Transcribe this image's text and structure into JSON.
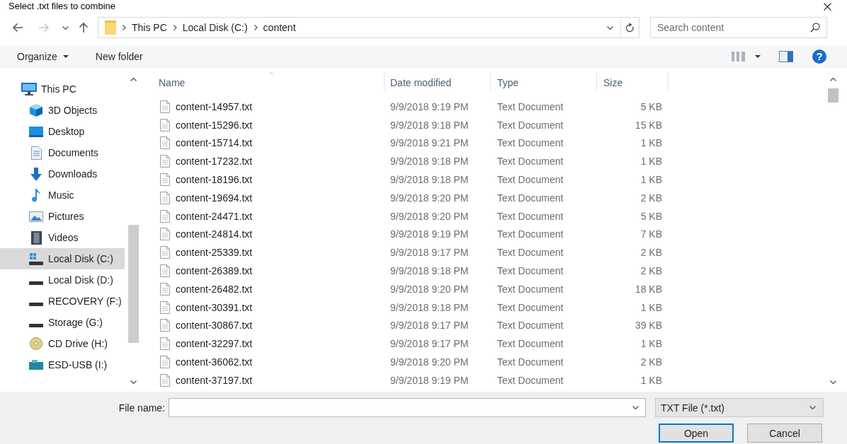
{
  "window": {
    "title": "Select .txt files to combine"
  },
  "nav_buttons": [
    {
      "kind": "back",
      "disabled": false
    },
    {
      "kind": "forward",
      "disabled": true
    },
    {
      "kind": "recent",
      "disabled": false
    },
    {
      "kind": "up",
      "disabled": false
    }
  ],
  "address_bar": {
    "breadcrumbs": [
      "This PC",
      "Local Disk (C:)",
      "content"
    ]
  },
  "search": {
    "placeholder": "Search content"
  },
  "toolbar": {
    "organize": "Organize",
    "new_folder": "New folder",
    "help": "?"
  },
  "sidebar": {
    "items": [
      {
        "label": "This PC",
        "kind": "pc",
        "selected": false,
        "children": [
          {
            "label": "3D Objects",
            "kind": "objects3d",
            "selected": false
          },
          {
            "label": "Desktop",
            "kind": "desktop",
            "selected": false
          },
          {
            "label": "Documents",
            "kind": "documents",
            "selected": false
          },
          {
            "label": "Downloads",
            "kind": "downloads",
            "selected": false
          },
          {
            "label": "Music",
            "kind": "music",
            "selected": false
          },
          {
            "label": "Pictures",
            "kind": "pictures",
            "selected": false
          },
          {
            "label": "Videos",
            "kind": "videos",
            "selected": false
          },
          {
            "label": "Local Disk (C:)",
            "kind": "system_disk",
            "selected": true
          },
          {
            "label": "Local Disk (D:)",
            "kind": "disk",
            "selected": false
          },
          {
            "label": "RECOVERY (F:)",
            "kind": "disk",
            "selected": false
          },
          {
            "label": "Storage (G:)",
            "kind": "disk",
            "selected": false
          },
          {
            "label": "CD Drive (H:)",
            "kind": "cd",
            "selected": false
          },
          {
            "label": "ESD-USB (I:)",
            "kind": "usb",
            "selected": false
          }
        ]
      }
    ]
  },
  "file_list": {
    "columns": [
      {
        "label": "Name",
        "sorted": true
      },
      {
        "label": "Date modified",
        "sorted": false
      },
      {
        "label": "Type",
        "sorted": false
      },
      {
        "label": "Size",
        "sorted": false
      }
    ],
    "rows": [
      {
        "name": "content-14957.txt",
        "date_modified": "9/9/2018 9:19 PM",
        "type": "Text Document",
        "size": "5 KB"
      },
      {
        "name": "content-15296.txt",
        "date_modified": "9/9/2018 9:18 PM",
        "type": "Text Document",
        "size": "15 KB"
      },
      {
        "name": "content-15714.txt",
        "date_modified": "9/9/2018 9:21 PM",
        "type": "Text Document",
        "size": "1 KB"
      },
      {
        "name": "content-17232.txt",
        "date_modified": "9/9/2018 9:18 PM",
        "type": "Text Document",
        "size": "1 KB"
      },
      {
        "name": "content-18196.txt",
        "date_modified": "9/9/2018 9:18 PM",
        "type": "Text Document",
        "size": "1 KB"
      },
      {
        "name": "content-19694.txt",
        "date_modified": "9/9/2018 9:20 PM",
        "type": "Text Document",
        "size": "2 KB"
      },
      {
        "name": "content-24471.txt",
        "date_modified": "9/9/2018 9:20 PM",
        "type": "Text Document",
        "size": "5 KB"
      },
      {
        "name": "content-24814.txt",
        "date_modified": "9/9/2018 9:19 PM",
        "type": "Text Document",
        "size": "7 KB"
      },
      {
        "name": "content-25339.txt",
        "date_modified": "9/9/2018 9:17 PM",
        "type": "Text Document",
        "size": "2 KB"
      },
      {
        "name": "content-26389.txt",
        "date_modified": "9/9/2018 9:18 PM",
        "type": "Text Document",
        "size": "2 KB"
      },
      {
        "name": "content-26482.txt",
        "date_modified": "9/9/2018 9:20 PM",
        "type": "Text Document",
        "size": "18 KB"
      },
      {
        "name": "content-30391.txt",
        "date_modified": "9/9/2018 9:18 PM",
        "type": "Text Document",
        "size": "1 KB"
      },
      {
        "name": "content-30867.txt",
        "date_modified": "9/9/2018 9:17 PM",
        "type": "Text Document",
        "size": "39 KB"
      },
      {
        "name": "content-32297.txt",
        "date_modified": "9/9/2018 9:17 PM",
        "type": "Text Document",
        "size": "1 KB"
      },
      {
        "name": "content-36062.txt",
        "date_modified": "9/9/2018 9:20 PM",
        "type": "Text Document",
        "size": "2 KB"
      },
      {
        "name": "content-37197.txt",
        "date_modified": "9/9/2018 9:19 PM",
        "type": "Text Document",
        "size": "1 KB"
      }
    ]
  },
  "footer": {
    "file_name_label": "File name:",
    "file_type": "TXT File (*.txt)",
    "buttons": [
      {
        "label": "Open",
        "default": true
      },
      {
        "label": "Cancel",
        "default": false
      }
    ]
  }
}
